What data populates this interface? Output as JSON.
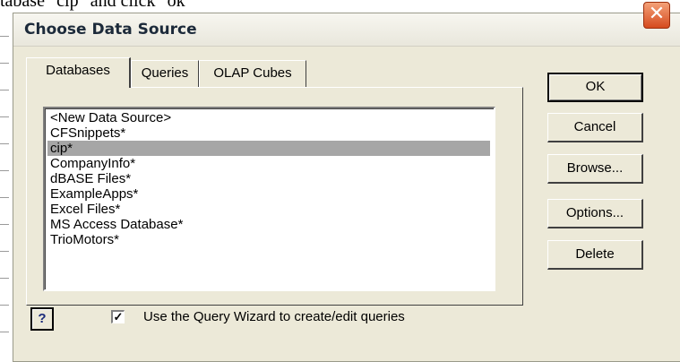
{
  "background_text": "tabase \"cip\" and click \"ok\"",
  "dialog": {
    "title": "Choose Data Source",
    "close_glyph": "✕"
  },
  "tabs": [
    {
      "label": "Databases",
      "active": true
    },
    {
      "label": "Queries",
      "active": false
    },
    {
      "label": "OLAP Cubes",
      "active": false
    }
  ],
  "data_sources": [
    {
      "label": "<New Data Source>",
      "selected": false
    },
    {
      "label": "CFSnippets*",
      "selected": false
    },
    {
      "label": "cip*",
      "selected": true
    },
    {
      "label": "CompanyInfo*",
      "selected": false
    },
    {
      "label": "dBASE Files*",
      "selected": false
    },
    {
      "label": "ExampleApps*",
      "selected": false
    },
    {
      "label": "Excel Files*",
      "selected": false
    },
    {
      "label": "MS Access Database*",
      "selected": false
    },
    {
      "label": "TrioMotors*",
      "selected": false
    }
  ],
  "buttons": {
    "ok": "OK",
    "cancel": "Cancel",
    "browse": "Browse...",
    "options": "Options...",
    "delete": "Delete"
  },
  "help_glyph": "?",
  "query_wizard": {
    "checked": true,
    "check_glyph": "✓",
    "label": "Use the Query Wizard to create/edit queries"
  },
  "colors": {
    "dialog_face": "#ece9d8",
    "selection": "#a6a6a6",
    "close_button": "#d54a1e"
  }
}
